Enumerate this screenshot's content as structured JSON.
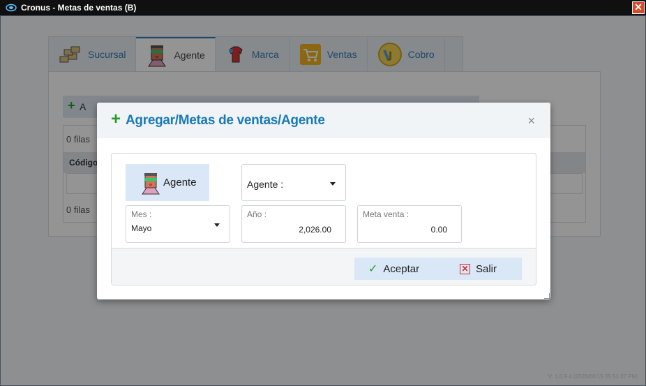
{
  "window": {
    "title": "Cronus - Metas de ventas (B)",
    "close_glyph": "✕"
  },
  "tabs": [
    {
      "label": "Sucursal",
      "icon": "bricks-icon"
    },
    {
      "label": "Agente",
      "icon": "agent-icon"
    },
    {
      "label": "Marca",
      "icon": "brand-icon"
    },
    {
      "label": "Ventas",
      "icon": "cart-icon"
    },
    {
      "label": "Cobro",
      "icon": "coin-icon"
    }
  ],
  "background": {
    "toolbar_label": "A",
    "rows_top": "0 filas",
    "column_header": "Código",
    "rows_bottom": "0 filas",
    "version": "V: 1.0.9.4 (2026/06/15 05:51:27 PM)"
  },
  "dialog": {
    "title": "Agregar/Metas de ventas/Agente",
    "close_glyph": "×",
    "agent_button_label": "Agente",
    "agent_select": {
      "value": "Agente :"
    },
    "mes": {
      "label": "Mes :",
      "value": "Mayo"
    },
    "anio": {
      "label": "Año :",
      "value": "2,026.00"
    },
    "meta": {
      "label": "Meta venta :",
      "value": "0.00"
    },
    "accept_label": "Aceptar",
    "exit_label": "Salir"
  },
  "colors": {
    "accent": "#1a7ab8",
    "green": "#2a9a2a",
    "red": "#d52b2b",
    "button_bg": "#d9e7f6"
  }
}
